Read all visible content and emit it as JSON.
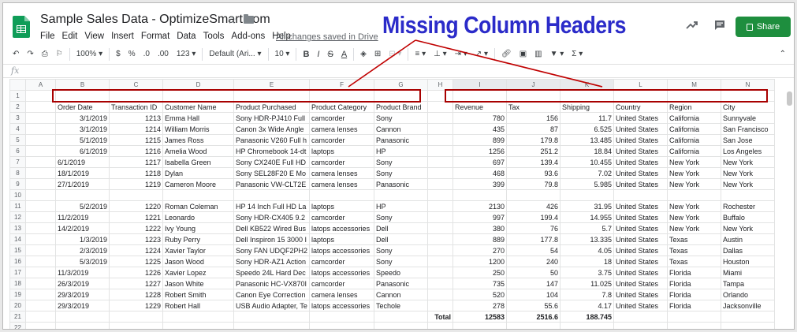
{
  "header": {
    "doc_title": "Sample Sales Data - OptimizeSmart.com",
    "saved_status": "All changes saved in Drive",
    "share_label": "Share",
    "menus": [
      "File",
      "Edit",
      "View",
      "Insert",
      "Format",
      "Data",
      "Tools",
      "Add-ons",
      "Help"
    ]
  },
  "annotation": {
    "title": "Missing Column Headers",
    "color": "#2b2bc9",
    "box_color": "#b00000"
  },
  "toolbar": {
    "zoom": "100%",
    "currency": "$",
    "percent": "%",
    "dec_less": ".0",
    "dec_more": ".00",
    "more_formats": "123",
    "font": "Default (Ari...",
    "font_size": "10",
    "bold": "B",
    "italic": "I",
    "strike": "S",
    "text_color": "A",
    "sigma": "Σ"
  },
  "formula_bar": {
    "label": "fx"
  },
  "grid": {
    "columns": [
      "",
      "A",
      "B",
      "C",
      "D",
      "E",
      "F",
      "G",
      "H",
      "I",
      "J",
      "K",
      "L",
      "M",
      "N"
    ],
    "rows": [
      [
        "1",
        "",
        "",
        "",
        "",
        "",
        "",
        "",
        "",
        "",
        "",
        "",
        "",
        "",
        ""
      ],
      [
        "2",
        "",
        "Order Date",
        "Transaction ID",
        "Customer Name",
        "Product Purchased",
        "Product Category",
        "Product Brand",
        "",
        "Revenue",
        "Tax",
        "Shipping",
        "Country",
        "Region",
        "City"
      ],
      [
        "3",
        "",
        "3/1/2019",
        "1213",
        "Emma Hall",
        "Sony HDR-PJ410 Full",
        "camcorder",
        "Sony",
        "",
        "780",
        "156",
        "11.7",
        "United States",
        "California",
        "Sunnyvale"
      ],
      [
        "4",
        "",
        "3/1/2019",
        "1214",
        "William Morris",
        "Canon 3x Wide Angle",
        "camera lenses",
        "Cannon",
        "",
        "435",
        "87",
        "6.525",
        "United States",
        "California",
        "San Francisco"
      ],
      [
        "5",
        "",
        "5/1/2019",
        "1215",
        "James Ross",
        "Panasonic V260 Full h",
        "camcorder",
        "Panasonic",
        "",
        "899",
        "179.8",
        "13.485",
        "United States",
        "California",
        "San Jose"
      ],
      [
        "6",
        "",
        "6/1/2019",
        "1216",
        "Amelia Wood",
        "HP Chromebook 14-dt",
        "laptops",
        "HP",
        "",
        "1256",
        "251.2",
        "18.84",
        "United States",
        "California",
        "Los Angeles"
      ],
      [
        "7",
        "",
        "6/1/2019",
        "1217",
        "Isabella Green",
        "Sony CX240E Full HD",
        "camcorder",
        "Sony",
        "",
        "697",
        "139.4",
        "10.455",
        "United States",
        "New York",
        "New York"
      ],
      [
        "8",
        "",
        "18/1/2019",
        "1218",
        "Dylan",
        "Sony SEL28F20 E Mo",
        "camera lenses",
        "Sony",
        "",
        "468",
        "93.6",
        "7.02",
        "United States",
        "New York",
        "New York"
      ],
      [
        "9",
        "",
        "27/1/2019",
        "1219",
        "Cameron Moore",
        "Panasonic VW-CLT2E",
        "camera lenses",
        "Panasonic",
        "",
        "399",
        "79.8",
        "5.985",
        "United States",
        "New York",
        "New York"
      ],
      [
        "10",
        "",
        "",
        "",
        "",
        "",
        "",
        "",
        "",
        "",
        "",
        "",
        "",
        "",
        ""
      ],
      [
        "11",
        "",
        "5/2/2019",
        "1220",
        "Roman Coleman",
        "HP 14 Inch Full HD La",
        "laptops",
        "HP",
        "",
        "2130",
        "426",
        "31.95",
        "United States",
        "New York",
        "Rochester"
      ],
      [
        "12",
        "",
        "11/2/2019",
        "1221",
        "Leonardo",
        "Sony HDR-CX405 9.2",
        "camcorder",
        "Sony",
        "",
        "997",
        "199.4",
        "14.955",
        "United States",
        "New York",
        "Buffalo"
      ],
      [
        "13",
        "",
        "14/2/2019",
        "1222",
        "Ivy Young",
        "Dell KB522 Wired Bus",
        "latops accessories",
        "Dell",
        "",
        "380",
        "76",
        "5.7",
        "United States",
        "New York",
        "New York"
      ],
      [
        "14",
        "",
        "1/3/2019",
        "1223",
        "Ruby Perry",
        "Dell Inspiron 15 3000 I",
        "laptops",
        "Dell",
        "",
        "889",
        "177.8",
        "13.335",
        "United States",
        "Texas",
        "Austin"
      ],
      [
        "15",
        "",
        "2/3/2019",
        "1224",
        "Xavier Taylor",
        "Sony FAN UDQF2PH2",
        "latops accessories",
        "Sony",
        "",
        "270",
        "54",
        "4.05",
        "United States",
        "Texas",
        "Dallas"
      ],
      [
        "16",
        "",
        "5/3/2019",
        "1225",
        "Jason Wood",
        "Sony HDR-AZ1 Action",
        "camcorder",
        "Sony",
        "",
        "1200",
        "240",
        "18",
        "United States",
        "Texas",
        "Houston"
      ],
      [
        "17",
        "",
        "11/3/2019",
        "1226",
        "Xavier Lopez",
        "Speedo 24L Hard Dec",
        "latops accessories",
        "Speedo",
        "",
        "250",
        "50",
        "3.75",
        "United States",
        "Florida",
        "Miami"
      ],
      [
        "18",
        "",
        "26/3/2019",
        "1227",
        "Jason White",
        "Panasonic HC-VX870I",
        "camcorder",
        "Panasonic",
        "",
        "735",
        "147",
        "11.025",
        "United States",
        "Florida",
        "Tampa"
      ],
      [
        "19",
        "",
        "29/3/2019",
        "1228",
        "Robert Smith",
        "Canon Eye Correction",
        "camera lenses",
        "Cannon",
        "",
        "520",
        "104",
        "7.8",
        "United States",
        "Florida",
        "Orlando"
      ],
      [
        "20",
        "",
        "29/3/2019",
        "1229",
        "Robert Hall",
        "USB Audio Adapter, Te",
        "latops accessories",
        "Techole",
        "",
        "278",
        "55.6",
        "4.17",
        "United States",
        "Florida",
        "Jacksonville"
      ],
      [
        "21",
        "",
        "",
        "",
        "",
        "",
        "",
        "",
        "Total",
        "12583",
        "2516.6",
        "188.745",
        "",
        "",
        ""
      ],
      [
        "22",
        "",
        "",
        "",
        "",
        "",
        "",
        "",
        "",
        "",
        "",
        "",
        "",
        "",
        ""
      ]
    ]
  }
}
